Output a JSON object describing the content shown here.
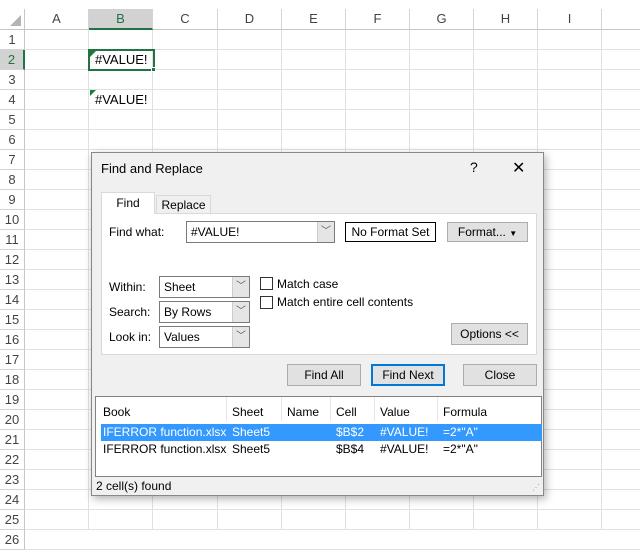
{
  "sheet": {
    "columns": [
      "A",
      "B",
      "C",
      "D",
      "E",
      "F",
      "G",
      "H",
      "I"
    ],
    "rows": [
      "1",
      "2",
      "3",
      "4",
      "5",
      "6",
      "7",
      "8",
      "9",
      "10",
      "11",
      "12",
      "13",
      "14",
      "15",
      "16",
      "17",
      "18",
      "19",
      "20",
      "21",
      "22",
      "23",
      "24",
      "25",
      "26"
    ],
    "cells": {
      "B2": "#VALUE!",
      "B4": "#VALUE!"
    },
    "active_cell": "B2",
    "accent": "#217346"
  },
  "dialog": {
    "title": "Find and Replace",
    "help": "?",
    "close": "✕",
    "tabs": [
      {
        "label": "Find",
        "active": true
      },
      {
        "label": "Replace",
        "active": false
      }
    ],
    "find_what_label": "Find what:",
    "find_what_value": "#VALUE!",
    "no_format": "No Format Set",
    "format_button": "Format...",
    "within_label": "Within:",
    "within_value": "Sheet",
    "search_label": "Search:",
    "search_value": "By Rows",
    "lookin_label": "Look in:",
    "lookin_value": "Values",
    "match_case": "Match case",
    "match_case_checked": false,
    "match_entire": "Match entire cell contents",
    "match_entire_checked": false,
    "options_button": "Options <<",
    "find_all": "Find All",
    "find_next": "Find Next",
    "close_button": "Close",
    "results": {
      "headers": [
        "Book",
        "Sheet",
        "Name",
        "Cell",
        "Value",
        "Formula"
      ],
      "rows": [
        {
          "book": "IFERROR function.xlsx",
          "sheet": "Sheet5",
          "name": "",
          "cell": "$B$2",
          "value": "#VALUE!",
          "formula": "=2*\"A\"",
          "selected": true
        },
        {
          "book": "IFERROR function.xlsx",
          "sheet": "Sheet5",
          "name": "",
          "cell": "$B$4",
          "value": "#VALUE!",
          "formula": "=2*\"A\"",
          "selected": false
        }
      ]
    },
    "status": "2 cell(s) found",
    "selection_color": "#3399ff"
  }
}
